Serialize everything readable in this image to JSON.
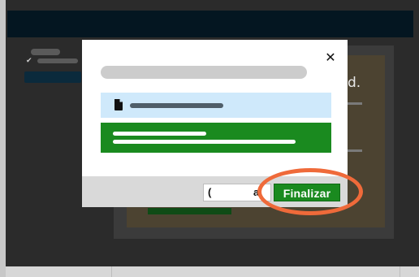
{
  "modal": {
    "close_icon": "close-icon",
    "file_icon": "file-icon",
    "footer": {
      "cancel_label_start": "(",
      "cancel_label_end": "a",
      "finish_label": "Finalizar"
    }
  },
  "background": {
    "partial_text": "d."
  },
  "colors": {
    "finish_button": "#1a8a1f",
    "highlight": "#ef6a3a",
    "file_row": "#cfe9fb",
    "overlay": "#2b2b2b"
  }
}
